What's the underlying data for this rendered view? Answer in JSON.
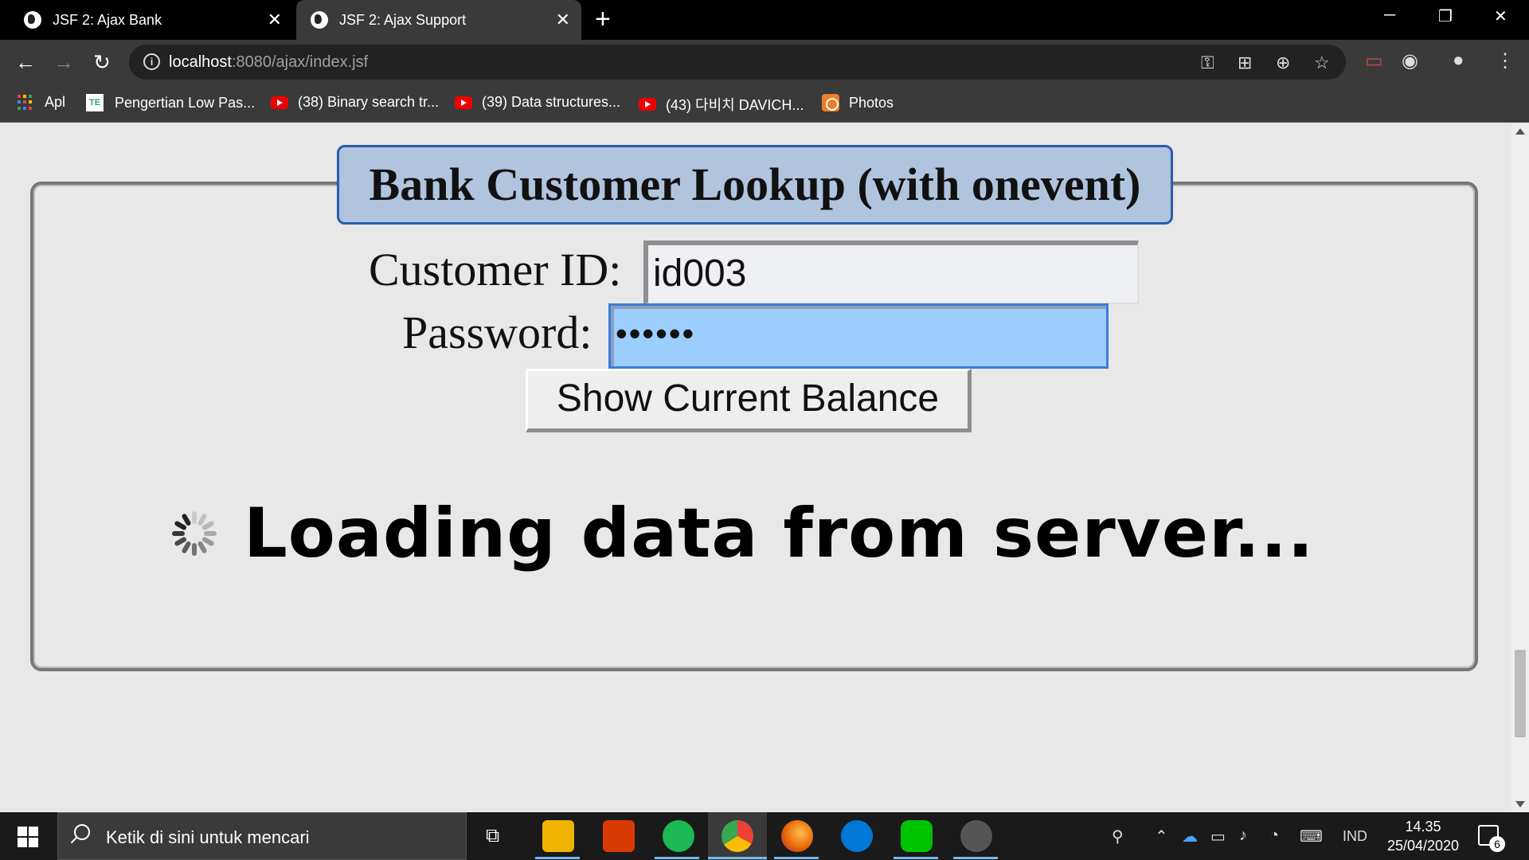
{
  "browser": {
    "tabs": [
      {
        "title": "JSF 2: Ajax Bank",
        "close": "✕"
      },
      {
        "title": "JSF 2: Ajax Support",
        "close": "✕"
      }
    ],
    "new_tab": "+",
    "window_controls": {
      "minimize": "─",
      "restore": "❐",
      "close": "✕"
    },
    "nav": {
      "back": "←",
      "forward": "→",
      "reload": "↻"
    },
    "url_host": "localhost",
    "url_rest": ":8080/ajax/index.jsf",
    "bookmarks": [
      {
        "label": "Apl",
        "icon": "apps-grid-icon"
      },
      {
        "label": "Pengertian Low Pas...",
        "icon": "site-icon"
      },
      {
        "label": "(38) Binary search tr...",
        "icon": "youtube-icon"
      },
      {
        "label": "(39) Data structures...",
        "icon": "youtube-icon"
      },
      {
        "label": "(43) 다비치 DAVICH...",
        "icon": "youtube-icon"
      },
      {
        "label": "Photos",
        "icon": "photos-icon"
      }
    ]
  },
  "page": {
    "legend": "Bank Customer Lookup (with onevent)",
    "customer_id_label": "Customer ID:",
    "customer_id_value": "id003",
    "password_label": "Password:",
    "password_value": "••••••",
    "submit_label": "Show Current Balance",
    "loading_text": "Loading data from server..."
  },
  "taskbar": {
    "search_placeholder": "Ketik di sini untuk mencari",
    "language": "IND",
    "time": "14.35",
    "date": "25/04/2020",
    "notification_count": "6"
  },
  "colors": {
    "legend_bg": "#b0c4de",
    "legend_border": "#2a5db0",
    "password_bg": "#9ccfff",
    "password_border": "#3d7be0"
  }
}
